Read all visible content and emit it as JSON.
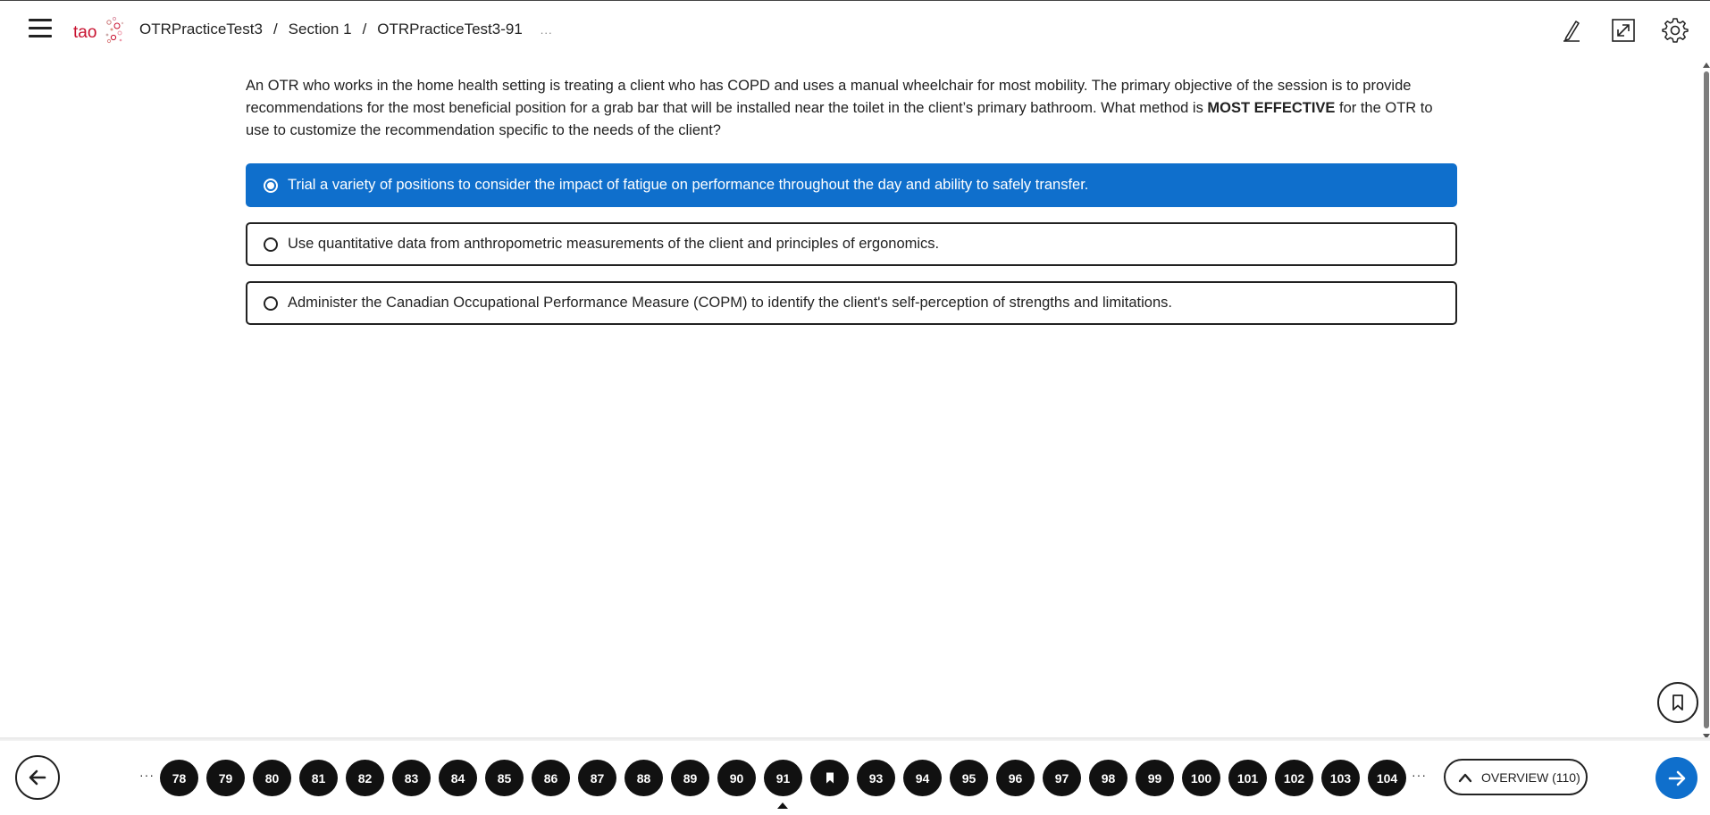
{
  "header": {
    "menu_icon": "hamburger-icon",
    "logo_text": "tao",
    "breadcrumb": [
      "OTRPracticeTest3",
      "Section 1",
      "OTRPracticeTest3-91"
    ],
    "breadcrumb_more": "...",
    "tools": [
      "pencil-icon",
      "expand-icon",
      "gear-icon"
    ]
  },
  "question": {
    "text_before": "An OTR who works in the home health setting is treating a client who has COPD and uses a manual wheelchair for most mobility. The primary objective of the session is to provide recommendations for the most beneficial position for a grab bar that will be installed near the toilet in the client’s primary bathroom. What method is ",
    "emphasis": "MOST EFFECTIVE",
    "text_after": " for the OTR to use to customize the recommendation specific to the needs of the client?"
  },
  "choices": [
    {
      "label": "Trial a variety of positions to consider the impact of fatigue on performance throughout the day and ability to safely transfer.",
      "selected": true
    },
    {
      "label": "Use quantitative data from anthropometric measurements of the client and principles of ergonomics.",
      "selected": false
    },
    {
      "label": "Administer the Canadian Occupational Performance Measure (COPM) to identify the client's self-perception of strengths and limitations.",
      "selected": false
    }
  ],
  "footer": {
    "left_ellipsis": "···",
    "right_ellipsis": "···",
    "nav_items": [
      "78",
      "79",
      "80",
      "81",
      "82",
      "83",
      "84",
      "85",
      "86",
      "87",
      "88",
      "89",
      "90",
      "91",
      "",
      "93",
      "94",
      "95",
      "96",
      "97",
      "98",
      "99",
      "100",
      "101",
      "102",
      "103",
      "104"
    ],
    "current_item": "91",
    "flagged_item_index": 14,
    "overview_label": "OVERVIEW (110)"
  },
  "colors": {
    "accent": "#0f6fcc",
    "nav_item_bg": "#111111"
  }
}
